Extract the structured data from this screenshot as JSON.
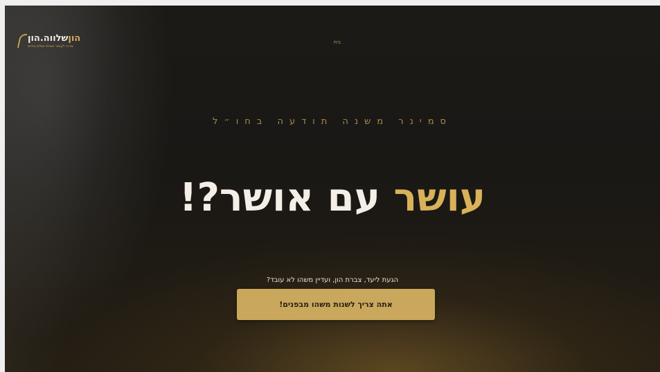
{
  "header": {
    "logo": {
      "title_gold": "הון",
      "title_rest": "שלווה.הון",
      "subtitle": "מרכז לעושר אמיתי ושלם בחיים"
    },
    "nav_link": "בית"
  },
  "hero": {
    "kicker": "סמינר משנה תודעה בחו״ל",
    "headline_gold": "עושר",
    "headline_rest": " עם אושר?!",
    "subtitle": "הגעת ליעד, צברת הון, ועדיין משהו לא עובד?",
    "cta_label": "אתה צריך לשנות משהו מבפנים!"
  },
  "colors": {
    "background": "#1c1a17",
    "accent_gold": "#d8b15a",
    "button_gold": "#c9a75c",
    "text_light": "#f3efe6"
  }
}
